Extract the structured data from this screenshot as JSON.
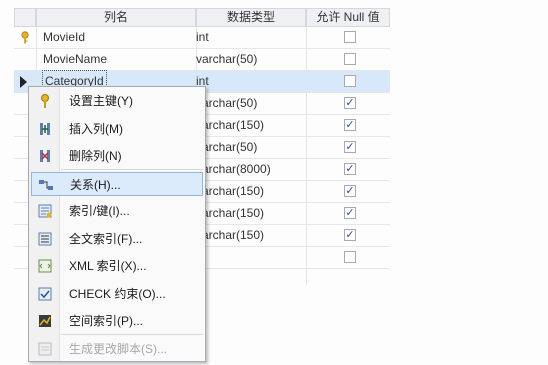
{
  "headers": {
    "name": "列名",
    "type": "数据类型",
    "nulls": "允许 Null 值"
  },
  "rows": [
    {
      "name": "MovieId",
      "type": "int",
      "nulls": false,
      "pk": true
    },
    {
      "name": "MovieName",
      "type": "varchar(50)",
      "nulls": false
    },
    {
      "name": "CategoryId",
      "type": "int",
      "nulls": false,
      "selected": true
    },
    {
      "name": "",
      "type": "varchar(50)",
      "nulls": true
    },
    {
      "name": "",
      "type": "varchar(150)",
      "nulls": true
    },
    {
      "name": "",
      "type": "varchar(50)",
      "nulls": true
    },
    {
      "name": "",
      "type": "varchar(8000)",
      "nulls": true
    },
    {
      "name": "",
      "type": "varchar(150)",
      "nulls": true
    },
    {
      "name": "",
      "type": "varchar(150)",
      "nulls": true
    },
    {
      "name": "",
      "type": "varchar(150)",
      "nulls": true
    },
    {
      "name": "",
      "type": "",
      "nulls": false
    }
  ],
  "menu": {
    "items": [
      {
        "label": "设置主键(Y)",
        "icon": "key-icon"
      },
      {
        "label": "插入列(M)",
        "icon": "insert-column-icon"
      },
      {
        "label": "删除列(N)",
        "icon": "delete-column-icon"
      },
      {
        "label": "关系(H)...",
        "icon": "relationship-icon",
        "highlighted": true
      },
      {
        "label": "索引/键(I)...",
        "icon": "index-key-icon"
      },
      {
        "label": "全文索引(F)...",
        "icon": "fulltext-index-icon"
      },
      {
        "label": "XML 索引(X)...",
        "icon": "xml-index-icon"
      },
      {
        "label": "CHECK 约束(O)...",
        "icon": "check-constraint-icon"
      },
      {
        "label": "空间索引(P)...",
        "icon": "spatial-index-icon"
      },
      {
        "label": "生成更改脚本(S)...",
        "icon": "generate-script-icon",
        "disabled": true
      }
    ]
  },
  "colors": {
    "selected_row": "#d7e8fa",
    "menu_highlight": "#dcebfb",
    "check": "#2a4d8f"
  }
}
